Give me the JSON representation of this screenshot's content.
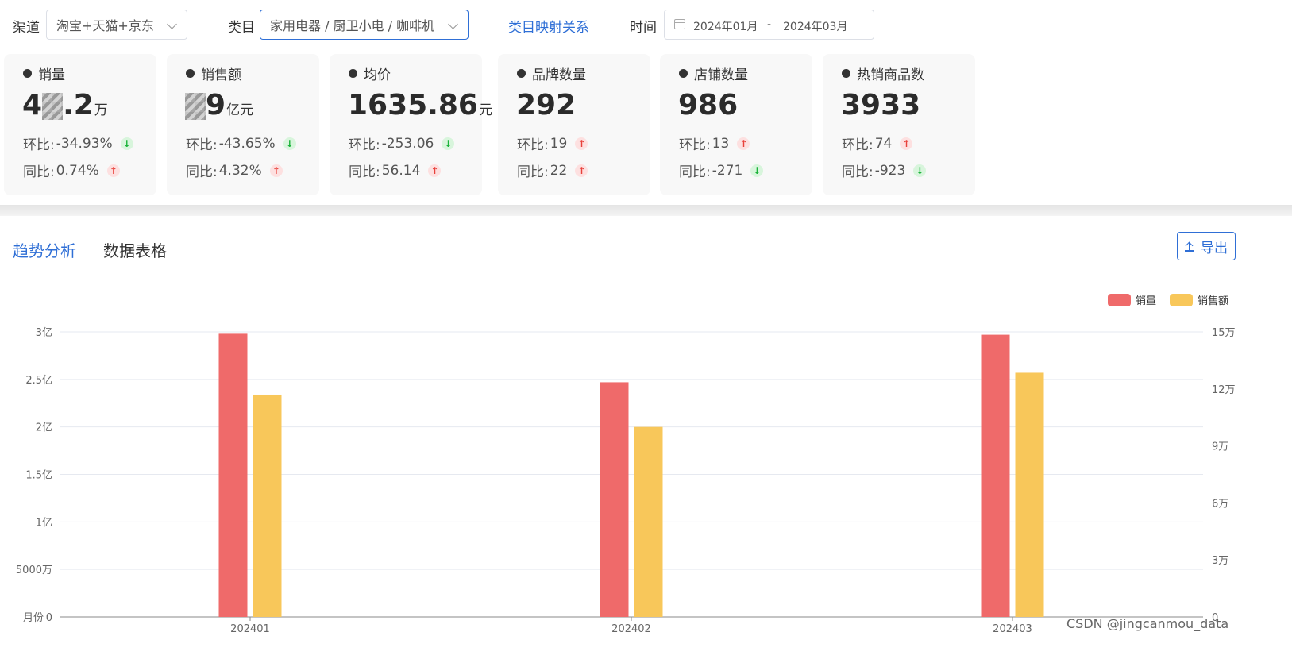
{
  "filters": {
    "channel_label": "渠道",
    "channel_value": "淘宝+天猫+京东",
    "category_label": "类目",
    "category_value": "家用电器 / 厨卫小电 / 咖啡机",
    "mapping_link": "类目映射关系",
    "time_label": "时间",
    "date_start": "2024年01月",
    "date_sep": "-",
    "date_end": "2024年03月"
  },
  "cards": [
    {
      "title": "销量",
      "value_prefix": "4",
      "value_suffix": ".2",
      "unit": "万",
      "mom_label": "环比:",
      "mom": "-34.93%",
      "mom_dir": "down",
      "yoy_label": "同比:",
      "yoy": "0.74%",
      "yoy_dir": "up",
      "masked": true
    },
    {
      "title": "销售额",
      "value_prefix": "",
      "value_suffix": "9",
      "unit": "亿元",
      "mom_label": "环比:",
      "mom": "-43.65%",
      "mom_dir": "down",
      "yoy_label": "同比:",
      "yoy": "4.32%",
      "yoy_dir": "up",
      "masked": true
    },
    {
      "title": "均价",
      "value_prefix": "1635.86",
      "value_suffix": "",
      "unit": "元",
      "mom_label": "环比:",
      "mom": "-253.06",
      "mom_dir": "down",
      "yoy_label": "同比:",
      "yoy": "56.14",
      "yoy_dir": "up",
      "masked": false
    },
    {
      "title": "品牌数量",
      "value_prefix": "292",
      "value_suffix": "",
      "unit": "",
      "mom_label": "环比:",
      "mom": "19",
      "mom_dir": "up",
      "yoy_label": "同比:",
      "yoy": "22",
      "yoy_dir": "up",
      "masked": false
    },
    {
      "title": "店铺数量",
      "value_prefix": "986",
      "value_suffix": "",
      "unit": "",
      "mom_label": "环比:",
      "mom": "13",
      "mom_dir": "up",
      "yoy_label": "同比:",
      "yoy": "-271",
      "yoy_dir": "down",
      "masked": false
    },
    {
      "title": "热销商品数",
      "value_prefix": "3933",
      "value_suffix": "",
      "unit": "",
      "mom_label": "环比:",
      "mom": "74",
      "mom_dir": "up",
      "yoy_label": "同比:",
      "yoy": "-923",
      "yoy_dir": "down",
      "masked": false
    }
  ],
  "tabs": {
    "trend": "趋势分析",
    "table": "数据表格",
    "export": "导出"
  },
  "colors": {
    "accent": "#2f6fd6",
    "series_sales": "#ef6a6a",
    "series_revenue": "#f8c75a"
  },
  "chart_data": {
    "type": "bar",
    "categories": [
      "202401",
      "202402",
      "202403"
    ],
    "series": [
      {
        "name": "销量",
        "values": [
          298000000,
          247000000,
          297000000
        ],
        "axis": "left"
      },
      {
        "name": "销售额",
        "values": [
          117000,
          100000,
          128500
        ],
        "axis": "right"
      }
    ],
    "left_ticks": [
      "0",
      "5000万",
      "1亿",
      "1.5亿",
      "2亿",
      "2.5亿",
      "3亿"
    ],
    "left_tick_values": [
      0,
      50000000,
      100000000,
      150000000,
      200000000,
      250000000,
      300000000
    ],
    "left_ylim": [
      0,
      300000000
    ],
    "right_ticks": [
      "0",
      "3万",
      "6万",
      "9万",
      "12万",
      "15万"
    ],
    "right_tick_values": [
      0,
      30000,
      60000,
      90000,
      120000,
      150000
    ],
    "right_ylim": [
      0,
      150000
    ],
    "xlabel": "月份",
    "legend_position": "top-right",
    "grid": true
  },
  "watermark": "CSDN @jingcanmou_data"
}
